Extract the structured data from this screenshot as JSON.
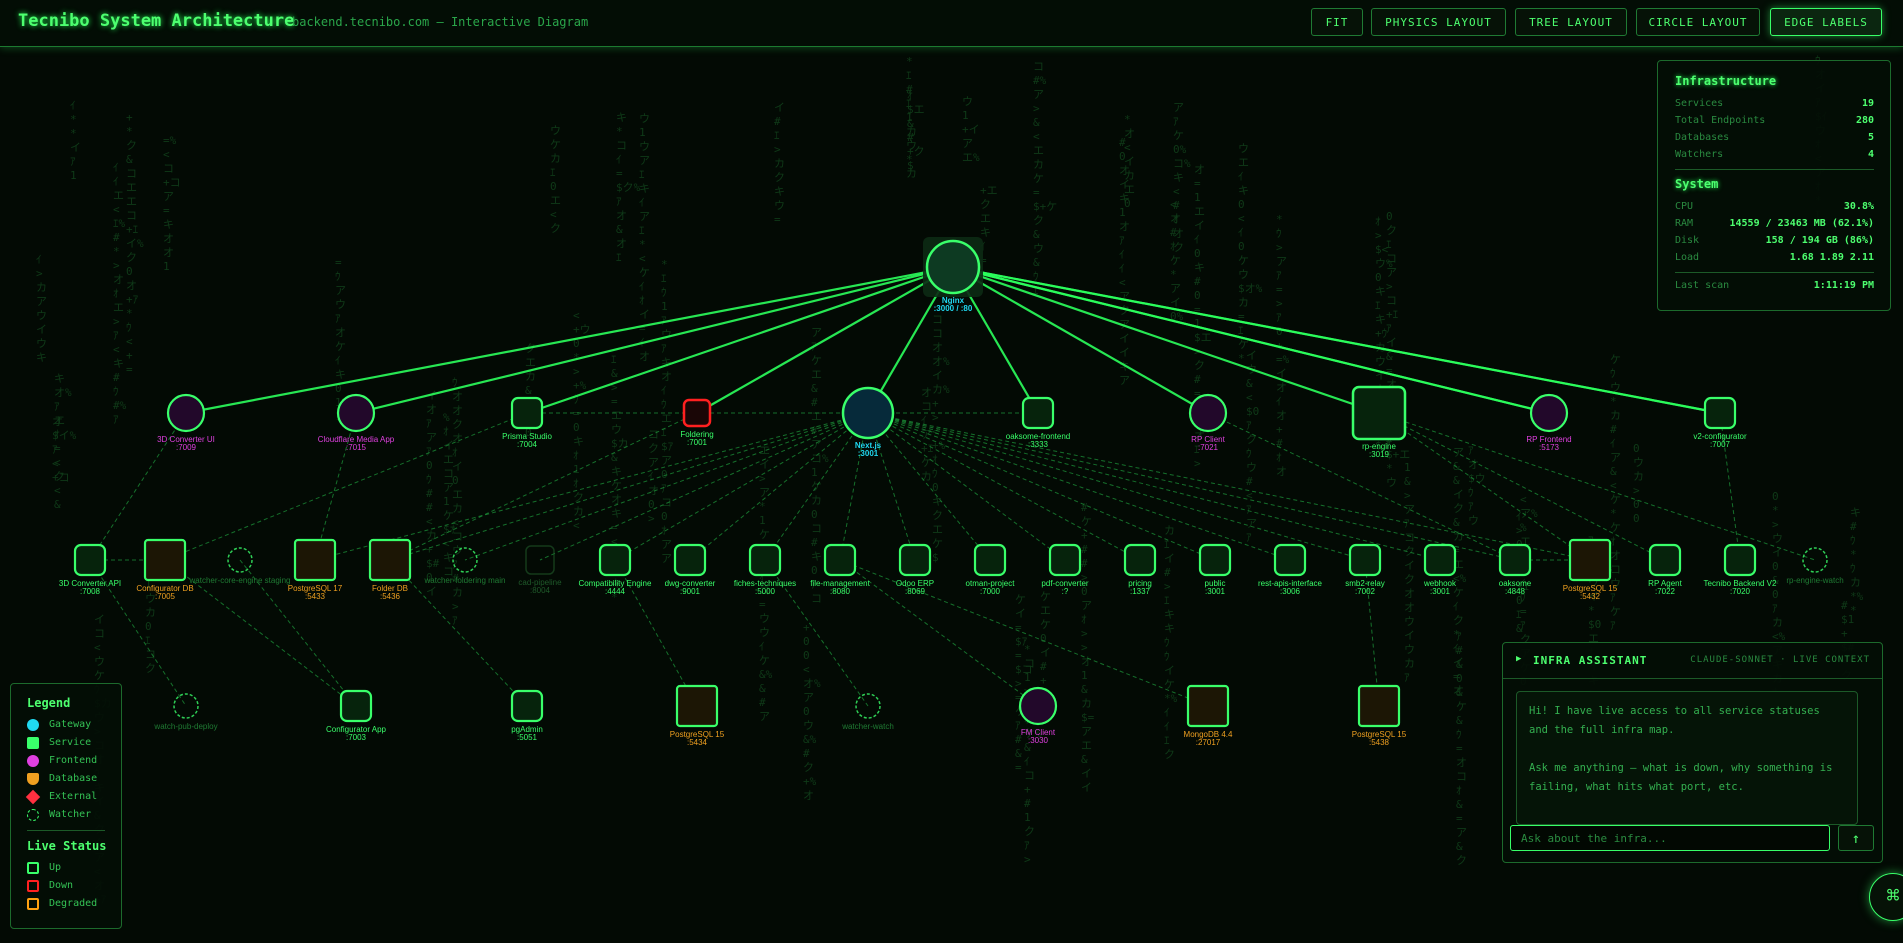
{
  "header": {
    "title": "Tecnibo System Architecture",
    "subtitle": "backend.tecnibo.com — Interactive Diagram",
    "buttons": [
      "FIT",
      "PHYSICS LAYOUT",
      "TREE LAYOUT",
      "CIRCLE LAYOUT",
      "EDGE LABELS"
    ],
    "active_button": "EDGE LABELS"
  },
  "infrastructure": {
    "title": "Infrastructure",
    "rows": [
      {
        "label": "Services",
        "value": "19"
      },
      {
        "label": "Total Endpoints",
        "value": "280"
      },
      {
        "label": "Databases",
        "value": "5"
      },
      {
        "label": "Watchers",
        "value": "4"
      }
    ],
    "system_title": "System",
    "system_rows": [
      {
        "label": "CPU",
        "value": "30.8%"
      },
      {
        "label": "RAM",
        "value": "14559 / 23463 MB (62.1%)"
      },
      {
        "label": "Disk",
        "value": "158 / 194 GB (86%)"
      },
      {
        "label": "Load",
        "value": "1.68 1.89 2.11"
      }
    ],
    "last_scan_label": "Last scan",
    "last_scan_value": "1:11:19 PM"
  },
  "legend": {
    "title": "Legend",
    "types": [
      {
        "label": "Gateway",
        "color": "#20d8f0"
      },
      {
        "label": "Service",
        "color": "#39ff6a"
      },
      {
        "label": "Frontend",
        "color": "#e040e0"
      },
      {
        "label": "Database",
        "color": "#f0a020"
      },
      {
        "label": "External",
        "color": "#ff3040"
      },
      {
        "label": "Watcher",
        "color": "#39ff6a"
      }
    ],
    "status_title": "Live Status",
    "statuses": [
      {
        "label": "Up",
        "color": "#39ff6a"
      },
      {
        "label": "Down",
        "color": "#ff2020"
      },
      {
        "label": "Degraded",
        "color": "#ffa010"
      }
    ]
  },
  "assistant": {
    "title": "INFRA ASSISTANT",
    "model": "CLAUDE-SONNET · LIVE CONTEXT",
    "message_1": "Hi! I have live access to all service statuses and the full infra map.",
    "message_2": "Ask me anything — what is down, why something is failing, what hits what port, etc.",
    "input_placeholder": "Ask about the infra...",
    "send_icon": "arrow-up-icon",
    "fab_icon": "command-icon"
  },
  "nodes": [
    {
      "id": "nginx",
      "name": "Nginx",
      "port": ":3000 / :80",
      "kind": "gateway"
    },
    {
      "id": "3dconv-ui",
      "name": "3D Converter UI",
      "port": ":7009",
      "kind": "frontend"
    },
    {
      "id": "cf-media",
      "name": "Cloudflare Media App",
      "port": ":7015",
      "kind": "frontend"
    },
    {
      "id": "prisma",
      "name": "Prisma Studio",
      "port": ":7004",
      "kind": "service"
    },
    {
      "id": "foldering",
      "name": "Foldering",
      "port": ":7001",
      "kind": "external"
    },
    {
      "id": "nextjs",
      "name": "Next.js",
      "port": ":3001",
      "kind": "gateway-node"
    },
    {
      "id": "oaksome-fe",
      "name": "oaksome-frontend",
      "port": ":3333",
      "kind": "service"
    },
    {
      "id": "rp-client",
      "name": "RP Client",
      "port": ":7021",
      "kind": "frontend"
    },
    {
      "id": "rp-engine",
      "name": "rp-engine",
      "port": ":3019",
      "kind": "service-large"
    },
    {
      "id": "rp-frontend",
      "name": "RP Frontend",
      "port": ":5173",
      "kind": "frontend"
    },
    {
      "id": "v2-conf",
      "name": "v2-configurator",
      "port": ":7007",
      "kind": "service"
    },
    {
      "id": "3dconv-api",
      "name": "3D Converter API",
      "port": ":7008",
      "kind": "service"
    },
    {
      "id": "conf-db",
      "name": "Configurator DB",
      "port": ":7005",
      "kind": "database"
    },
    {
      "id": "watch-core",
      "name": "watcher-core-engine staging",
      "port": "",
      "kind": "watcher"
    },
    {
      "id": "pg17",
      "name": "PostgreSQL 17",
      "port": ":5433",
      "kind": "database"
    },
    {
      "id": "folder-db",
      "name": "Folder DB",
      "port": ":5436",
      "kind": "database"
    },
    {
      "id": "watch-fold",
      "name": "watcher-foldering main",
      "port": "",
      "kind": "watcher"
    },
    {
      "id": "cad-pipe",
      "name": "cad-pipeline",
      "port": ":8004",
      "kind": "faded"
    },
    {
      "id": "compat",
      "name": "Compatibility Engine",
      "port": ":4444",
      "kind": "service"
    },
    {
      "id": "dwg",
      "name": "dwg-converter",
      "port": ":9001",
      "kind": "service"
    },
    {
      "id": "fiches",
      "name": "fiches-techniques",
      "port": ":5000",
      "kind": "service"
    },
    {
      "id": "filemgmt",
      "name": "file-management",
      "port": ":8080",
      "kind": "service"
    },
    {
      "id": "odoo",
      "name": "Odoo ERP",
      "port": ":8069",
      "kind": "service"
    },
    {
      "id": "otman",
      "name": "otman-project",
      "port": ":7000",
      "kind": "service"
    },
    {
      "id": "pdfconv",
      "name": "pdf-converter",
      "port": ":?",
      "kind": "service"
    },
    {
      "id": "pricing",
      "name": "pricing",
      "port": ":1337",
      "kind": "service"
    },
    {
      "id": "public",
      "name": "public",
      "port": ":3001",
      "kind": "service"
    },
    {
      "id": "restapis",
      "name": "rest-apis-interface",
      "port": ":3006",
      "kind": "service"
    },
    {
      "id": "smb2",
      "name": "smb2-relay",
      "port": ":7002",
      "kind": "service"
    },
    {
      "id": "webhook",
      "name": "webhook",
      "port": ":3001",
      "kind": "service"
    },
    {
      "id": "oaksome",
      "name": "oaksome",
      "port": ":4848",
      "kind": "service"
    },
    {
      "id": "pg15a",
      "name": "PostgreSQL 15",
      "port": ":5432",
      "kind": "database"
    },
    {
      "id": "rp-agent",
      "name": "RP Agent",
      "port": ":7022",
      "kind": "service"
    },
    {
      "id": "tecnibo-be",
      "name": "Tecnibo Backend V2",
      "port": ":7020",
      "kind": "service"
    },
    {
      "id": "watch-rp",
      "name": "rp-engine-watch",
      "port": "",
      "kind": "watcher"
    },
    {
      "id": "watch-pub",
      "name": "watch-pub-deploy",
      "port": "",
      "kind": "watcher"
    },
    {
      "id": "conf-app",
      "name": "Configurator App",
      "port": ":7003",
      "kind": "service"
    },
    {
      "id": "pgadmin",
      "name": "pgAdmin",
      "port": ":5051",
      "kind": "service"
    },
    {
      "id": "pg15b",
      "name": "PostgreSQL 15",
      "port": ":5434",
      "kind": "database"
    },
    {
      "id": "watch-con",
      "name": "watcher-watch",
      "port": "",
      "kind": "watcher"
    },
    {
      "id": "fm-client",
      "name": "FM Client",
      "port": ":3030",
      "kind": "frontend"
    },
    {
      "id": "mongo",
      "name": "MongoDB 4.4",
      "port": ":27017",
      "kind": "database"
    },
    {
      "id": "pg15c",
      "name": "PostgreSQL 15",
      "port": ":5438",
      "kind": "database"
    }
  ]
}
